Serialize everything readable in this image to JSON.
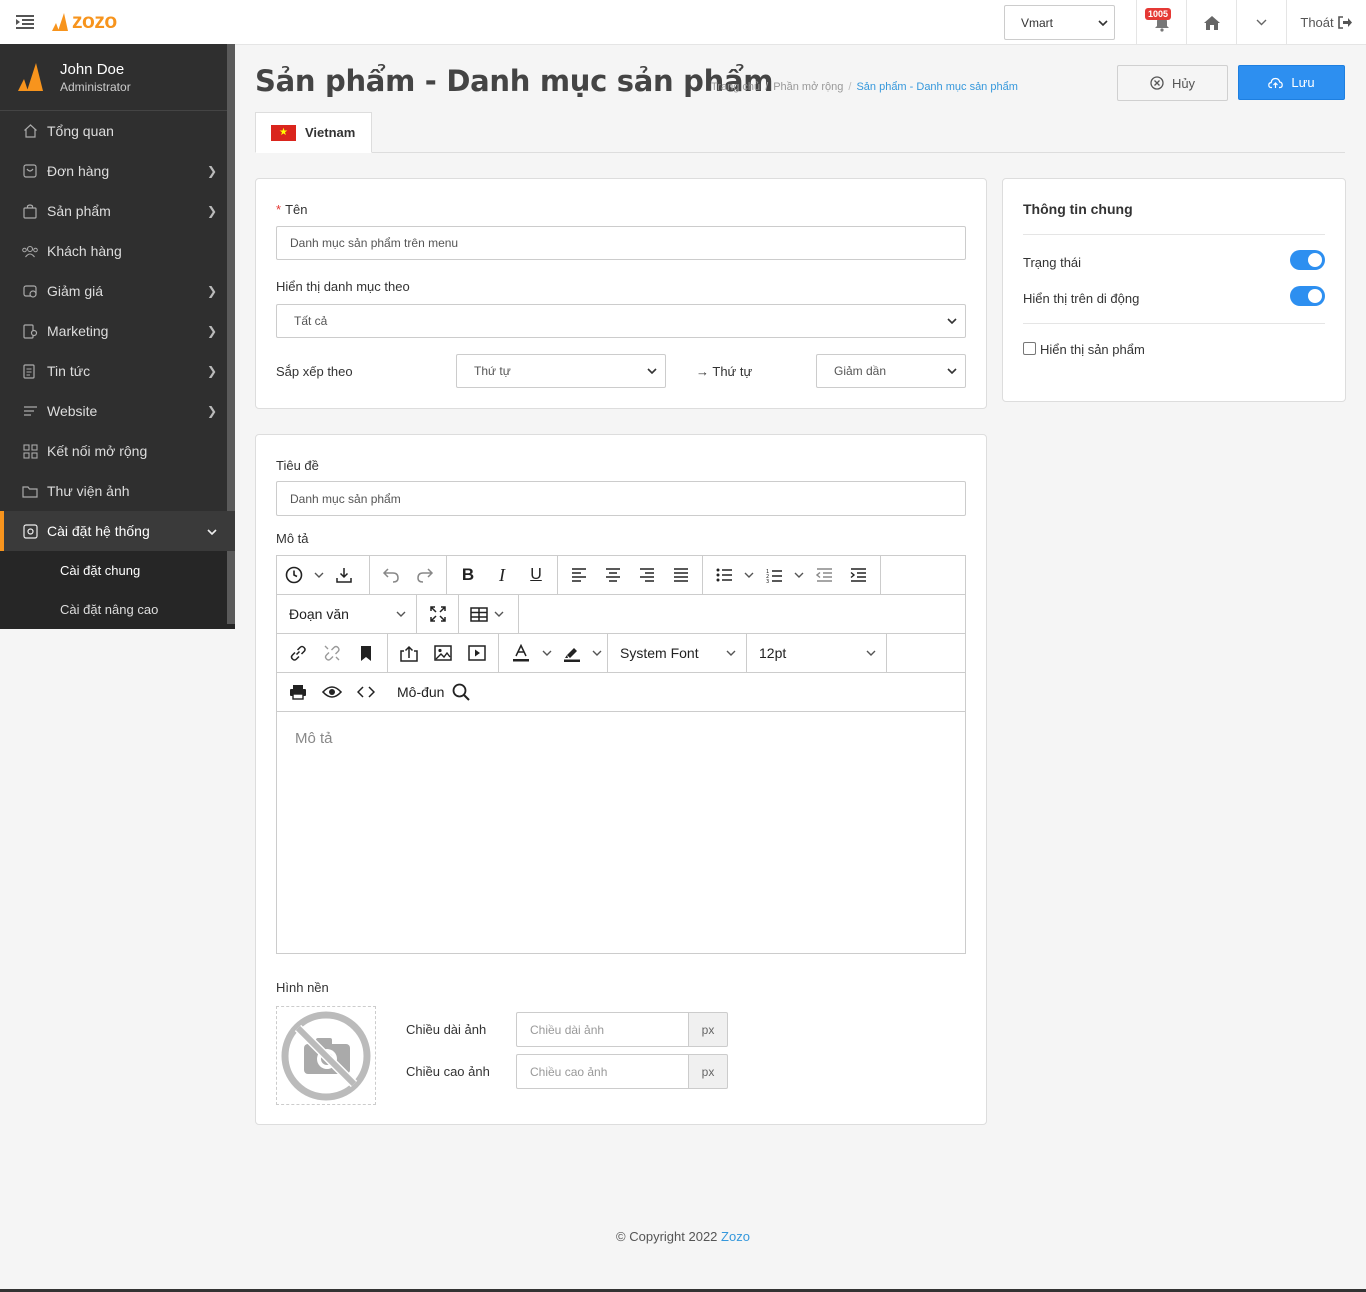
{
  "brand": {
    "logo_text": "zozo",
    "accent": "#f7941d"
  },
  "topbar": {
    "store": "Vmart",
    "notifications": "1005",
    "logout": "Thoát"
  },
  "user": {
    "name": "John Doe",
    "role": "Administrator"
  },
  "sidebar": {
    "items": [
      {
        "label": "Tổng quan",
        "icon": "home-icon"
      },
      {
        "label": "Đơn hàng",
        "icon": "cart-icon"
      },
      {
        "label": "Sản phẩm",
        "icon": "bag-icon"
      },
      {
        "label": "Khách hàng",
        "icon": "users-icon"
      },
      {
        "label": "Giảm giá",
        "icon": "tag-icon"
      },
      {
        "label": "Marketing",
        "icon": "megaphone-icon"
      },
      {
        "label": "Tin tức",
        "icon": "news-icon"
      },
      {
        "label": "Website",
        "icon": "list-icon"
      },
      {
        "label": "Kết nối mở rộng",
        "icon": "grid-icon"
      },
      {
        "label": "Thư viện ảnh",
        "icon": "folder-icon"
      },
      {
        "label": "Cài đặt hệ thống",
        "icon": "settings-icon"
      }
    ],
    "sub": [
      "Cài đặt chung",
      "Cài đặt nâng cao"
    ]
  },
  "page": {
    "title": "Sản phẩm - Danh mục sản phẩm",
    "breadcrumb": [
      "Trang chủ",
      "Phần mở rộng",
      "Sản phẩm - Danh mục sản phẩm"
    ],
    "cancel": "Hủy",
    "save": "Lưu",
    "tab": "Vietnam"
  },
  "form": {
    "name_label": "Tên",
    "name_value": "Danh mục sản phẩm trên menu",
    "display_label": "Hiển thị danh mục theo",
    "display_value": "Tất cả",
    "sort_label": "Sắp xếp theo",
    "sort_value": "Thứ tự",
    "order_label": "→ Thứ tự",
    "order_value": "Giảm dần",
    "title_label": "Tiêu đề",
    "title_value": "Danh mục sản phẩm",
    "desc_label": "Mô tả",
    "desc_placeholder": "Mô tả",
    "bg_label": "Hình nền",
    "width_label": "Chiều dài ảnh",
    "width_placeholder": "Chiều dài ảnh",
    "height_label": "Chiều cao ảnh",
    "height_placeholder": "Chiều cao ảnh",
    "unit": "px"
  },
  "editor": {
    "paragraph": "Đoạn văn",
    "font": "System Font",
    "size": "12pt",
    "module": "Mô-đun"
  },
  "general": {
    "title": "Thông tin chung",
    "status": "Trạng thái",
    "mobile": "Hiển thị trên di động",
    "show_products": "Hiển thị sản phẩm",
    "status_on": true,
    "mobile_on": true,
    "show_products_checked": false
  },
  "footer": {
    "text": "© Copyright 2022",
    "link": "Zozo"
  }
}
